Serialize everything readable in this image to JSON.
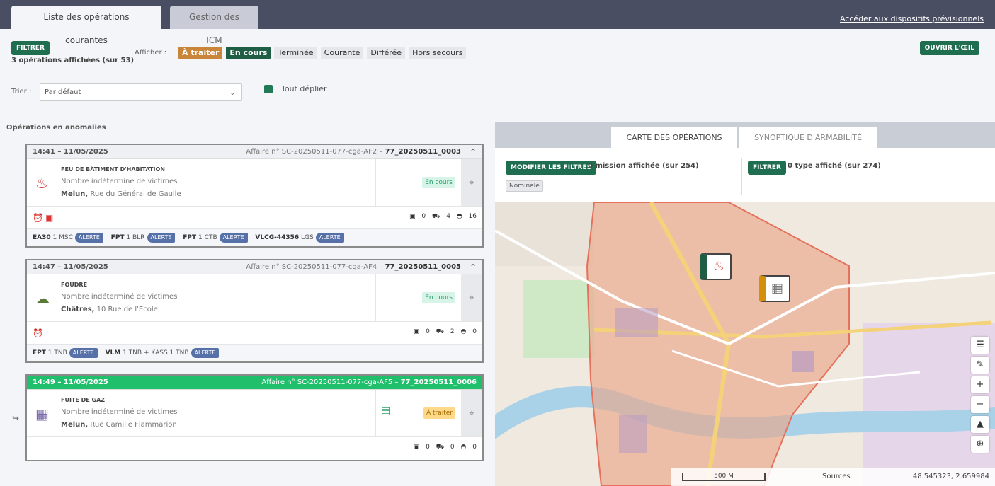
{
  "tabs": [
    {
      "label": "Liste des opérations courantes"
    },
    {
      "label": "Gestion des ICM"
    }
  ],
  "top_link": "Accéder aux dispositifs prévisionnels",
  "toolbar": {
    "filter_label": "FILTRER",
    "count_text": "3 opérations affichées (sur 53)",
    "afficher_label": "Afficher :",
    "chips": [
      "À traiter",
      "En cours",
      "Terminée",
      "Courante",
      "Différée",
      "Hors secours"
    ],
    "open_eye_label": "OUVRIR L'ŒIL"
  },
  "sort": {
    "label": "Trier :",
    "selected": "Par défaut",
    "unfold_label": "Tout déplier"
  },
  "anomalies_title": "Opérations en anomalies",
  "cards": [
    {
      "time": "14:41 – 11/05/2025",
      "affaire": "Affaire n° SC-20250511-077-cga-AF2 –",
      "number": "77_20250511_0003",
      "title": "FEU DE BÂTIMENT D'HABITATION",
      "victims": "Nombre indéterminé de victimes",
      "city": "Melun,",
      "street": "Rue du Général de Gaulle",
      "status": "En cours",
      "counts": [
        "0",
        "4",
        "16"
      ],
      "engines": [
        {
          "code": "EA30",
          "n": "1",
          "unit": "MSC",
          "alert": "ALERTE"
        },
        {
          "code": "FPT",
          "n": "1",
          "unit": "BLR",
          "alert": "ALERTE"
        },
        {
          "code": "FPT",
          "n": "1",
          "unit": "CTB",
          "alert": "ALERTE"
        },
        {
          "code": "VLCG-44356",
          "n": "",
          "unit": "LGS",
          "alert": "ALERTE"
        }
      ]
    },
    {
      "time": "14:47 – 11/05/2025",
      "affaire": "Affaire n° SC-20250511-077-cga-AF4 –",
      "number": "77_20250511_0005",
      "title": "FOUDRE",
      "victims": "Nombre indéterminé de victimes",
      "city": "Châtres,",
      "street": "10 Rue de l'Ecole",
      "status": "En cours",
      "counts": [
        "0",
        "2",
        "0"
      ],
      "engines": [
        {
          "code": "FPT",
          "n": "1",
          "unit": "TNB",
          "alert": "ALERTE"
        },
        {
          "code": "VLM",
          "n": "1",
          "unit": "TNB + KASS 1 TNB",
          "alert": "ALERTE"
        }
      ]
    },
    {
      "time": "14:49 – 11/05/2025",
      "affaire": "Affaire n° SC-20250511-077-cga-AF5 –",
      "number": "77_20250511_0006",
      "title": "FUITE DE GAZ",
      "victims": "Nombre indéterminé de victimes",
      "city": "Melun,",
      "street": "Rue Camille Flammarion",
      "status": "À traiter",
      "counts": [
        "0",
        "0",
        "0"
      ]
    }
  ],
  "map_panel": {
    "tab_ops": "CARTE DES OPÉRATIONS",
    "tab_syn": "SYNOPTIQUE D'ARMABILITÉ",
    "modify_filters": "MODIFIER LES FILTRES",
    "mission_count": "0 mission affichée (sur 254)",
    "nominale": "Nominale",
    "filter_label": "FILTRER",
    "type_count": "0 type affiché (sur 274)",
    "scale": "500 M",
    "sources": "Sources",
    "coords": "48.545323, 2.659984"
  },
  "colors": {
    "topbar": "#4a4e63",
    "green_btn": "#1f6e4f",
    "green_head": "#1fbf6b",
    "alert_pill": "#5671a8"
  }
}
